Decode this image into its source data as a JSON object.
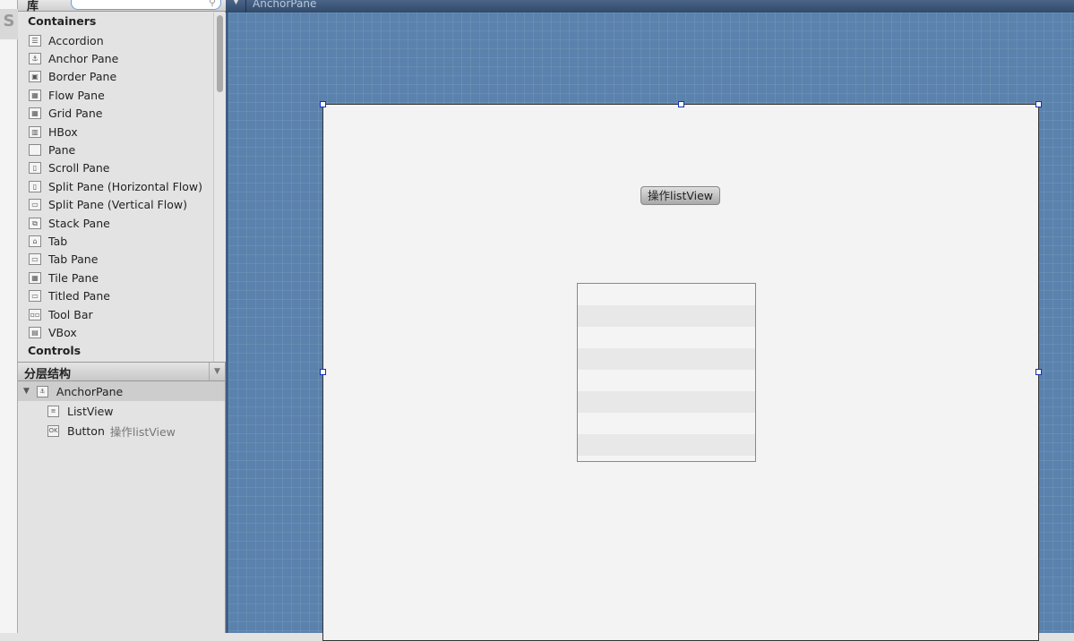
{
  "library": {
    "title": "库",
    "search_placeholder": "",
    "sections": [
      "Containers",
      "Controls"
    ],
    "containers": [
      {
        "label": "Accordion",
        "icon": "accordion-icon"
      },
      {
        "label": "Anchor Pane",
        "icon": "anchor-icon"
      },
      {
        "label": "Border Pane",
        "icon": "border-pane-icon"
      },
      {
        "label": "Flow Pane",
        "icon": "flow-pane-icon"
      },
      {
        "label": "Grid Pane",
        "icon": "grid-pane-icon"
      },
      {
        "label": "HBox",
        "icon": "hbox-icon"
      },
      {
        "label": "Pane",
        "icon": "pane-icon"
      },
      {
        "label": "Scroll Pane",
        "icon": "scroll-pane-icon"
      },
      {
        "label": "Split Pane (Horizontal Flow)",
        "icon": "split-h-icon"
      },
      {
        "label": "Split Pane (Vertical Flow)",
        "icon": "split-v-icon"
      },
      {
        "label": "Stack Pane",
        "icon": "stack-pane-icon"
      },
      {
        "label": "Tab",
        "icon": "tab-icon"
      },
      {
        "label": "Tab Pane",
        "icon": "tab-pane-icon"
      },
      {
        "label": "Tile Pane",
        "icon": "tile-pane-icon"
      },
      {
        "label": "Titled Pane",
        "icon": "titled-pane-icon"
      },
      {
        "label": "Tool Bar",
        "icon": "toolbar-icon"
      },
      {
        "label": "VBox",
        "icon": "vbox-icon"
      }
    ]
  },
  "hierarchy": {
    "title": "分层结构",
    "root": "AnchorPane",
    "children": [
      {
        "label": "ListView",
        "extra": ""
      },
      {
        "label": "Button",
        "extra": "操作listView"
      }
    ]
  },
  "canvas": {
    "breadcrumb": "AnchorPane",
    "button_label": "操作listView",
    "listview_rows": 8
  },
  "colors": {
    "canvas_bg": "#5a82ad",
    "selection_handle": "#1030c0"
  }
}
